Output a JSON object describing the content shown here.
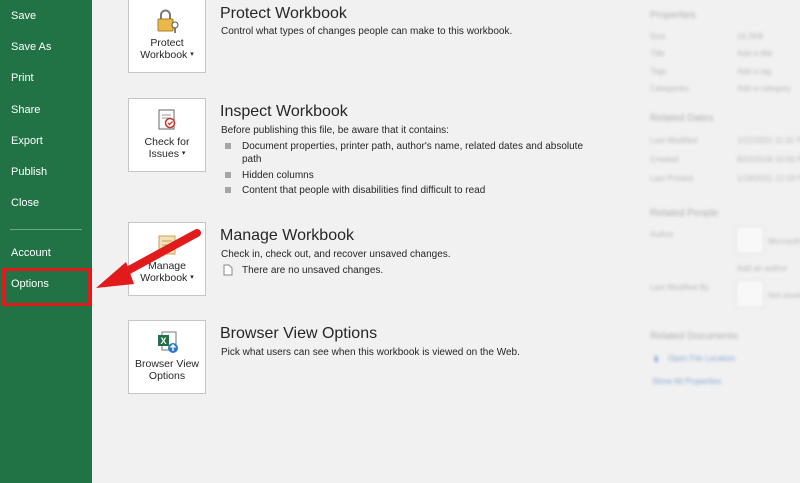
{
  "sidebar": {
    "items": [
      {
        "label": "Save"
      },
      {
        "label": "Save As"
      },
      {
        "label": "Print"
      },
      {
        "label": "Share"
      },
      {
        "label": "Export"
      },
      {
        "label": "Publish"
      },
      {
        "label": "Close"
      },
      {
        "label": "Account"
      },
      {
        "label": "Options"
      }
    ]
  },
  "sections": {
    "protect": {
      "btn_line1": "Protect",
      "btn_line2": "Workbook",
      "title": "Protect Workbook",
      "desc": "Control what types of changes people can make to this workbook."
    },
    "inspect": {
      "btn_line1": "Check for",
      "btn_line2": "Issues",
      "title": "Inspect Workbook",
      "desc": "Before publishing this file, be aware that it contains:",
      "bullets": [
        "Document properties, printer path, author's name, related dates and absolute path",
        "Hidden columns",
        "Content that people with disabilities find difficult to read"
      ]
    },
    "manage": {
      "btn_line1": "Manage",
      "btn_line2": "Workbook",
      "title": "Manage Workbook",
      "desc": "Check in, check out, and recover unsaved changes.",
      "note": "There are no unsaved changes."
    },
    "browser": {
      "btn_line1": "Browser View",
      "btn_line2": "Options",
      "title": "Browser View Options",
      "desc": "Pick what users can see when this workbook is viewed on the Web."
    }
  },
  "properties_panel": {
    "heading": "Properties",
    "rows": [
      {
        "label": "Size",
        "value": "16.2KB"
      },
      {
        "label": "Title",
        "value": "Add a title"
      },
      {
        "label": "Tags",
        "value": "Add a tag"
      },
      {
        "label": "Categories",
        "value": "Add a category"
      }
    ],
    "dates_heading": "Related Dates",
    "dates": [
      {
        "label": "Last Modified",
        "value": "1/22/2021 11:31 PM"
      },
      {
        "label": "Created",
        "value": "8/23/2018 10:56 PM"
      },
      {
        "label": "Last Printed",
        "value": "1/18/2021 12:18 PM"
      }
    ],
    "people_heading": "Related People",
    "author_label": "Author",
    "author_name": "Microsoft",
    "add_author": "Add an author",
    "modified_by_label": "Last Modified By",
    "modified_by_name": "Not saved yet",
    "documents_heading": "Related Documents",
    "open_location": "Open File Location",
    "show_all": "Show All Properties"
  },
  "colors": {
    "sidebar": "#217346",
    "highlight": "#e11b1b",
    "background": "#f1f1f1"
  }
}
